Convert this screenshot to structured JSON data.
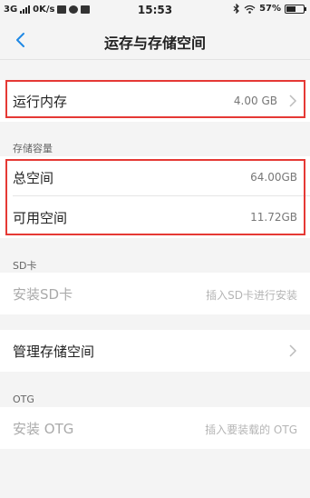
{
  "status_bar": {
    "network": "3G",
    "speed": "0K/s",
    "time": "15:53",
    "battery": "57%",
    "battery_level": 0.57,
    "icons": [
      "signal-icon",
      "mail-icon",
      "settings-icon",
      "log-icon",
      "bluetooth-icon",
      "wifi-icon",
      "battery-icon"
    ]
  },
  "header": {
    "title": "运存与存储空间",
    "back_icon": "back-arrow-icon"
  },
  "ram": {
    "label": "运行内存",
    "value": "4.00 GB"
  },
  "storage": {
    "section_label": "存储容量",
    "total_label": "总空间",
    "total_value": "64.00GB",
    "available_label": "可用空间",
    "available_value": "11.72GB"
  },
  "sd_card": {
    "section_label": "SD卡",
    "install_label": "安装SD卡",
    "install_hint": "插入SD卡进行安装"
  },
  "manage": {
    "label": "管理存储空间"
  },
  "otg": {
    "section_label": "OTG",
    "install_label": "安装 OTG",
    "install_hint": "插入要装载的 OTG"
  },
  "colors": {
    "highlight": "#e53935",
    "accent": "#1e88e5",
    "background": "#f4f4f4"
  }
}
